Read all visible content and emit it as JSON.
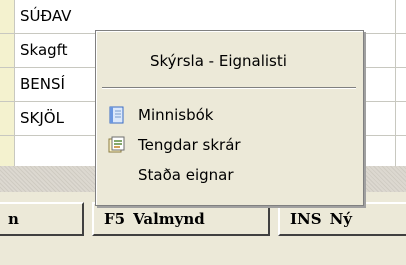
{
  "grid": {
    "rows": [
      {
        "text": "SÚÐAV"
      },
      {
        "text": "Skagft"
      },
      {
        "text": "BENSÍ"
      },
      {
        "text": "SKJÖL"
      }
    ]
  },
  "context_menu": {
    "header": "Skýrsla - Eignalisti",
    "items": [
      {
        "label": "Minnisbók",
        "icon": "notebook-icon"
      },
      {
        "label": "Tengdar skrár",
        "icon": "linked-files-icon"
      },
      {
        "label": "Staða eignar",
        "icon": ""
      }
    ]
  },
  "function_keys": {
    "left_fragment": "n",
    "f5_key": "F5",
    "f5_label": "Valmynd",
    "ins_key": "INS",
    "ins_label": "Ný"
  },
  "colors": {
    "selector": "#f4f2cf",
    "menu_bg": "#ece9d8",
    "toolbar_bg": "#ece9d8"
  }
}
